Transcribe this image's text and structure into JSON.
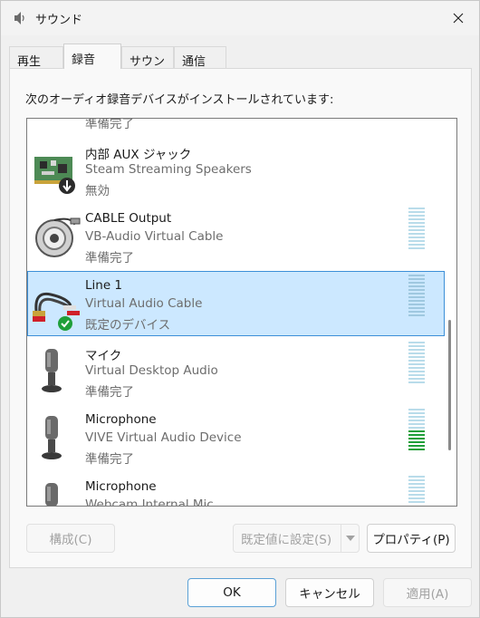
{
  "window": {
    "title": "サウンド",
    "close_icon": "close-icon",
    "app_icon": "speaker-icon"
  },
  "tabs": [
    {
      "label": "再生",
      "active": false
    },
    {
      "label": "録音",
      "active": true
    },
    {
      "label": "サウンド",
      "active": false
    },
    {
      "label": "通信",
      "active": false
    }
  ],
  "instruction": "次のオーディオ録音デバイスがインストールされています:",
  "devices": [
    {
      "name": "",
      "description": "",
      "status": "準備完了",
      "icon": "microphone-icon"
    },
    {
      "name": "内部 AUX ジャック",
      "description": "Steam Streaming Speakers",
      "status": "無効",
      "icon": "sound-card-disabled-icon"
    },
    {
      "name": "CABLE Output",
      "description": "VB-Audio Virtual Cable",
      "status": "準備完了",
      "icon": "cable-reel-icon"
    },
    {
      "name": "Line 1",
      "description": "Virtual Audio Cable",
      "status": "既定のデバイス",
      "icon": "rca-cable-default-icon",
      "selected": true
    },
    {
      "name": "マイク",
      "description": "Virtual Desktop Audio",
      "status": "準備完了",
      "icon": "microphone-icon"
    },
    {
      "name": "Microphone",
      "description": "VIVE Virtual Audio Device",
      "status": "準備完了",
      "icon": "microphone-icon",
      "level_segments_on": 6
    },
    {
      "name": "Microphone",
      "description": "Webcam Internal Mic",
      "status": "",
      "icon": "microphone-icon"
    }
  ],
  "buttons": {
    "configure": "構成(C)",
    "set_default": "既定値に設定(S)",
    "properties": "プロパティ(P)",
    "ok": "OK",
    "cancel": "キャンセル",
    "apply": "適用(A)"
  },
  "colors": {
    "selection": "#cce8ff",
    "selection_border": "#3c8fd8",
    "meter_active": "#1f9f3a",
    "meter_idle": "#b9dcea"
  }
}
